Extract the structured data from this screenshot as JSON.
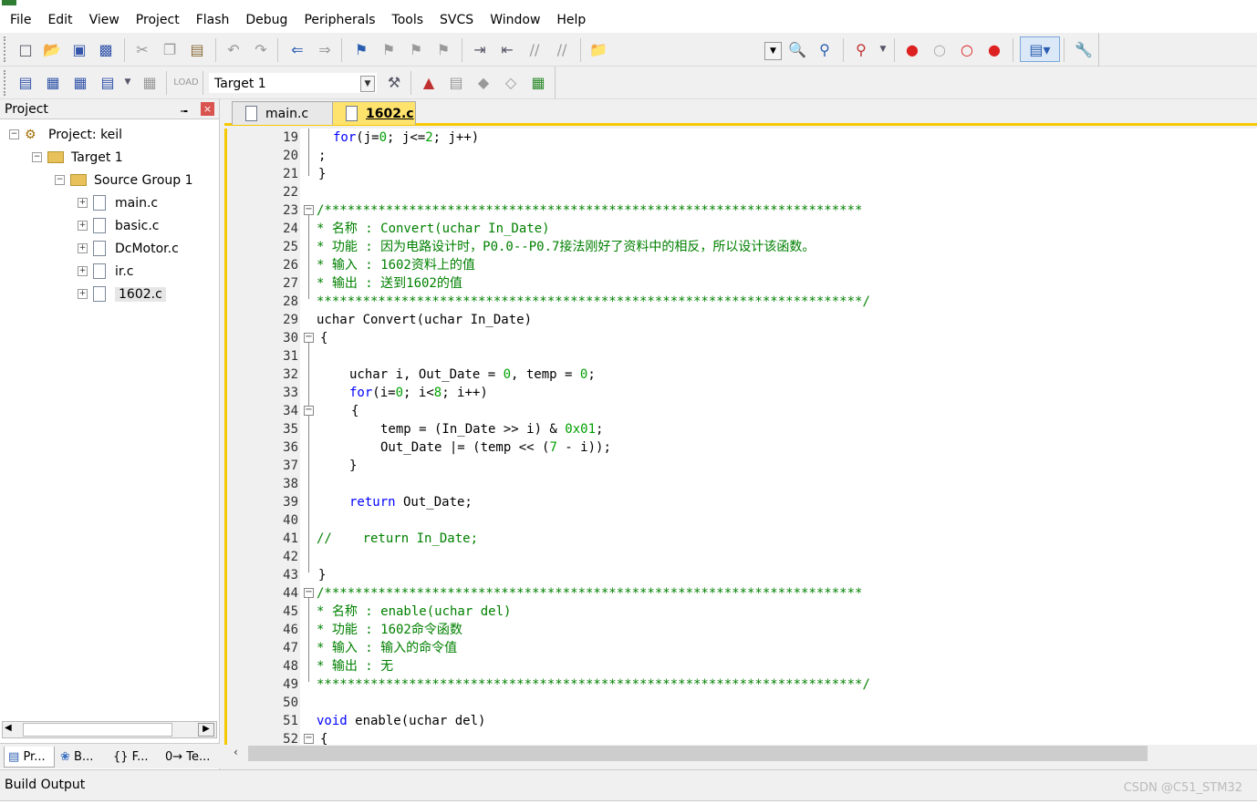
{
  "menu": [
    "File",
    "Edit",
    "View",
    "Project",
    "Flash",
    "Debug",
    "Peripherals",
    "Tools",
    "SVCS",
    "Window",
    "Help"
  ],
  "toolbar": {
    "target_value": "Target 1"
  },
  "project_pane": {
    "title": "Project",
    "root": "Project: keil",
    "target": "Target 1",
    "group": "Source Group 1",
    "files": [
      "main.c",
      "basic.c",
      "DcMotor.c",
      "ir.c",
      "1602.c"
    ],
    "bottom_tabs": [
      "Pr...",
      "B...",
      "{} F...",
      "0→ Te..."
    ]
  },
  "editor": {
    "tabs": [
      "main.c",
      "1602.c"
    ],
    "active_tab": "1602.c",
    "line_numbers": [
      "19",
      "20",
      "21",
      "22",
      "23",
      "24",
      "25",
      "26",
      "27",
      "28",
      "29",
      "30",
      "31",
      "32",
      "33",
      "34",
      "35",
      "36",
      "37",
      "38",
      "39",
      "40",
      "41",
      "42",
      "43",
      "44",
      "45",
      "46",
      "47",
      "48",
      "49",
      "50",
      "51",
      "52"
    ]
  },
  "code": {
    "l19_kw": "for",
    "l19_a": "(j=",
    "l19_n0": "0",
    "l19_b": "; j<=",
    "l19_n2": "2",
    "l19_c": "; j++)",
    "l20": ";",
    "l21": "}",
    "l23": "/**********************************************************************",
    "l24": "* 名称 : Convert(uchar In_Date)",
    "l25": "* 功能 : 因为电路设计时，P0.0--P0.7接法刚好了资料中的相反，所以设计该函数。",
    "l26": "* 输入 : 1602资料上的值",
    "l27": "* 输出 : 送到1602的值",
    "l28": "***********************************************************************/",
    "l29": "uchar Convert(uchar In_Date)",
    "l30": "{",
    "l32_a": "uchar i, Out_Date = ",
    "l32_n0": "0",
    "l32_b": ", temp = ",
    "l32_n1": "0",
    "l32_c": ";",
    "l33_kw": "for",
    "l33_a": "(i=",
    "l33_n0": "0",
    "l33_b": "; i<",
    "l33_n8": "8",
    "l33_c": "; i++)",
    "l34": "{",
    "l35_a": "temp = (In_Date >> i) & ",
    "l35_n": "0x01",
    "l35_c": ";",
    "l36_a": "Out_Date |= (temp << (",
    "l36_n": "7",
    "l36_c": " - i));",
    "l37": "}",
    "l39_kw": "return",
    "l39_a": " Out_Date;",
    "l41": "//    return In_Date;",
    "l43": "}",
    "l44": "/**********************************************************************",
    "l45": "* 名称 : enable(uchar del)",
    "l46": "* 功能 : 1602命令函数",
    "l47": "* 输入 : 输入的命令值",
    "l48": "* 输出 : 无",
    "l49": "***********************************************************************/",
    "l51_kw": "void",
    "l51_a": " enable(uchar del)",
    "l52": "{"
  },
  "build_output": {
    "title": "Build Output"
  },
  "watermark": "CSDN @C51_STM32",
  "colors": {
    "keyword": "#0000ff",
    "number": "#00a000",
    "comment": "#008000",
    "active_tab": "#ffe36d",
    "accent": "#f5c800"
  }
}
